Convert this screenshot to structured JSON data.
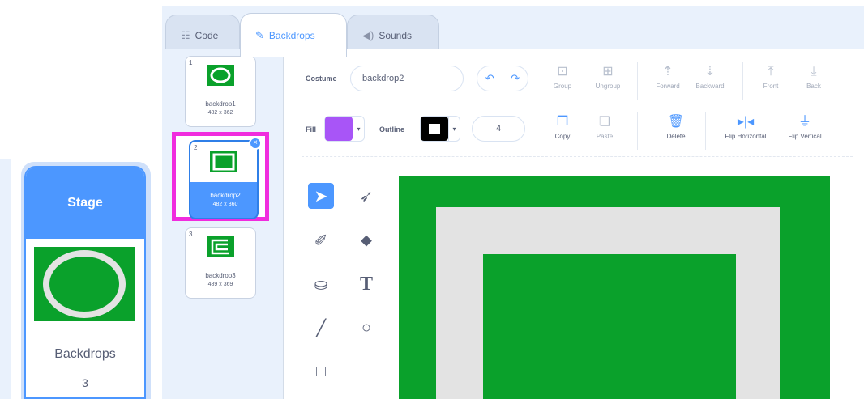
{
  "stage_panel": {
    "title": "Stage",
    "backdrops_label": "Backdrops",
    "backdrops_count": "3"
  },
  "tabs": [
    {
      "label": "Code",
      "icon": "code-blocks-icon"
    },
    {
      "label": "Backdrops",
      "icon": "paintbrush-icon"
    },
    {
      "label": "Sounds",
      "icon": "speaker-icon"
    }
  ],
  "backdrop_list": [
    {
      "num": "1",
      "name": "backdrop1",
      "size": "482 x 362"
    },
    {
      "num": "2",
      "name": "backdrop2",
      "size": "482 x 360"
    },
    {
      "num": "3",
      "name": "backdrop3",
      "size": "489 x 369"
    }
  ],
  "paint_editor": {
    "costume_label": "Costume",
    "costume_name": "backdrop2",
    "fill_label": "Fill",
    "outline_label": "Outline",
    "outline_width": "4",
    "fill_color": "#a855f7",
    "outline_color": "#000000",
    "canvas_green": "#0aa12b",
    "canvas_gray": "#e3e3e3",
    "accent": "#4c97ff",
    "selection_highlight": "#f02cde",
    "buttons": {
      "group": "Group",
      "ungroup": "Ungroup",
      "forward": "Forward",
      "backward": "Backward",
      "front": "Front",
      "back": "Back",
      "copy": "Copy",
      "paste": "Paste",
      "delete": "Delete",
      "flip_horizontal": "Flip Horizontal",
      "flip_vertical": "Flip Vertical"
    },
    "tools": [
      "select-arrow-icon",
      "reshape-icon",
      "brush-icon",
      "eraser-icon",
      "fill-bucket-icon",
      "text-icon",
      "line-icon",
      "circle-icon",
      "rectangle-icon"
    ],
    "text_tool_glyph": "T"
  }
}
